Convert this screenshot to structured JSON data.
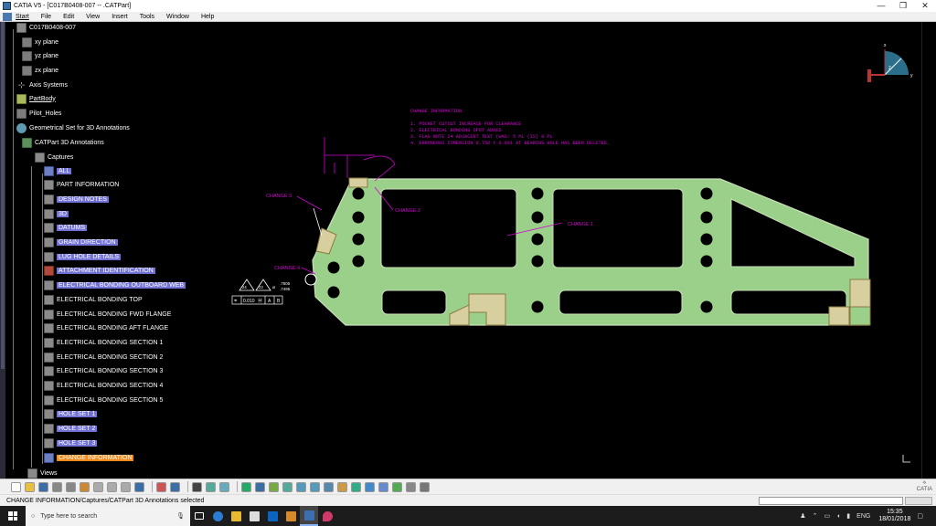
{
  "window": {
    "title": "CATIA V5 - [C017B0408-007 -- .CATPart]",
    "controls": {
      "minimize": "—",
      "maximize": "❐",
      "close": "✕"
    }
  },
  "menu": [
    "Start",
    "File",
    "Edit",
    "View",
    "Insert",
    "Tools",
    "Window",
    "Help"
  ],
  "tree": {
    "root": "C017B0408-007",
    "planes": [
      "xy plane",
      "yz plane",
      "zx plane"
    ],
    "axis": "Axis Systems",
    "partbody": "PartBody",
    "pilot": "Pilot_Holes",
    "geoset": "Geometrical Set for 3D Annotations",
    "annotations": "CATPart 3D Annotations",
    "captures": "Captures",
    "capture_items": [
      "ALL",
      "PART INFORMATION",
      "DESIGN NOTES",
      "3D",
      "DATUMS",
      "GRAIN DIRECTION",
      "LUG HOLE DETAILS",
      "ATTACHMENT IDENTIFICATION",
      "ELECTRICAL BONDING OUTBOARD WEB",
      "ELECTRICAL BONDING TOP",
      "ELECTRICAL BONDING FWD FLANGE",
      "ELECTRICAL BONDING AFT FLANGE",
      "ELECTRICAL BONDING  SECTION 1",
      "ELECTRICAL BONDING SECTION 2",
      "ELECTRICAL BONDING SECTION 3",
      "ELECTRICAL BONDING SECTION 4",
      "ELECTRICAL BONDING SECTION 5",
      "HOLE SET 1",
      "HOLE SET 2",
      "HOLE SET 3",
      "CHANGE INFORMATION"
    ],
    "views": "Views"
  },
  "annotation": {
    "header": "CHANGE INFORMATION",
    "lines": [
      "1. POCKET CUTOUT INCREASE FOR CLEARANCE",
      "2. ELECTRICAL BONDING SPOT ADDED",
      "3. FLAG NOTE 24 ADJACENT TEXT (WAS: 5 PL   (IS) 6 PL",
      "4. ERRONEOUS DIMENSION 0.750 ± 0.001 AT BEARING HOLE HAS BEEN DELETED."
    ],
    "callouts": [
      "CHANGE 1",
      "CHANGE 2",
      "CHANGE 3",
      "CHANGE 4"
    ],
    "flags": [
      "24",
      "23"
    ],
    "tolerance": {
      "symbol": "⌖",
      "value": "0.010",
      "mod": "Ⓜ",
      "a": "A",
      "b": "B"
    },
    "dim_upper": ".7505",
    "dim_lower": ".7495"
  },
  "compass_axes": {
    "x": "x",
    "y": "y",
    "z": "z"
  },
  "status": "CHANGE INFORMATION/Captures/CATPart 3D Annotations selected",
  "taskbar": {
    "search_placeholder": "Type here to search",
    "lang": "ENG",
    "time": "15:35",
    "date": "18/01/2018"
  },
  "colors": {
    "part_fill": "#9bd08a",
    "part_edge": "#c8e0b8",
    "annotation_magenta": "#d400d4",
    "pad_fill": "#d8cfa0",
    "highlight": "#7272d6",
    "selected": "#f08a1c"
  }
}
